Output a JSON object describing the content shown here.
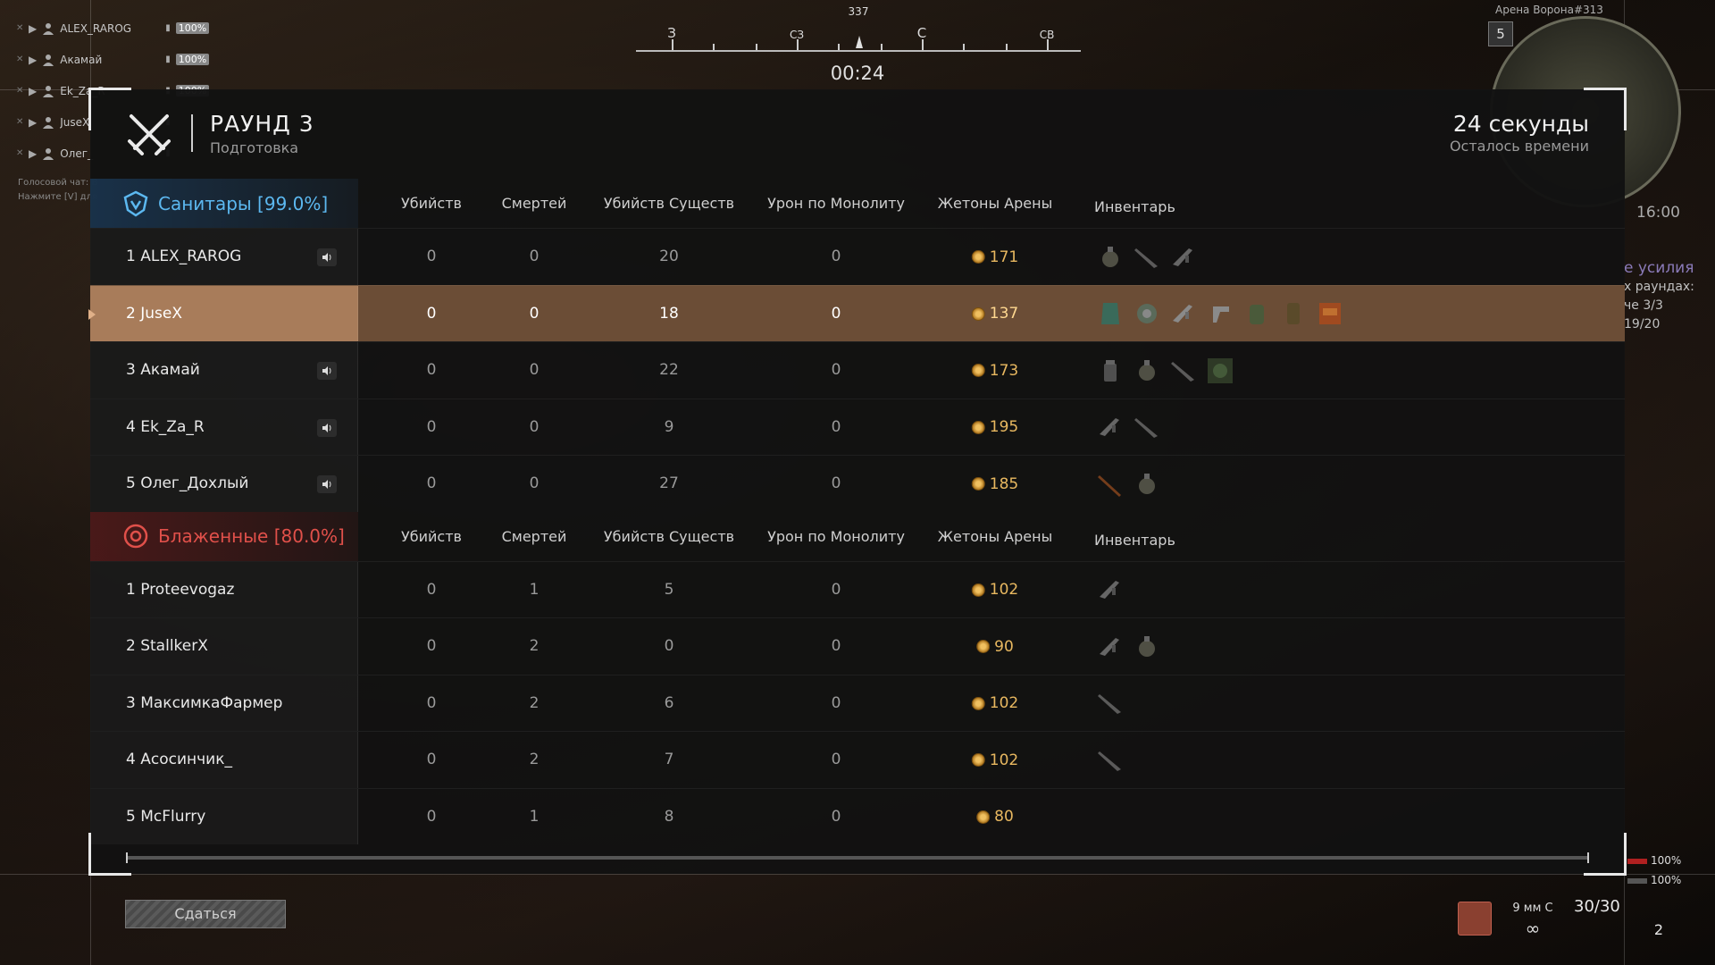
{
  "squad": {
    "members": [
      {
        "name": "ALEX_RAROG",
        "health": "100%"
      },
      {
        "name": "Акамай",
        "health": "100%"
      },
      {
        "name": "Ek_Za_R",
        "health": "100%"
      },
      {
        "name": "JuseX",
        "health": ""
      },
      {
        "name": "Олег_",
        "health": ""
      }
    ],
    "voice_note_1": "Голосовой чат: В",
    "voice_note_2": "Нажмите [V] для"
  },
  "compass": {
    "bearing": "337",
    "dir_w": "З",
    "dir_nw": "СЗ",
    "dir_n": "С",
    "dir_ne": "СВ"
  },
  "round_timer": "00:24",
  "minimap": {
    "map_name": "Арена Ворона#313",
    "level": "5",
    "clock": "16:00"
  },
  "task": {
    "line1": "е усилия",
    "line2": "х раундах:",
    "line3": "че 3/3",
    "line4": "19/20"
  },
  "header": {
    "round_title": "РАУНД 3",
    "round_phase": "Подготовка",
    "time_left": "24 секунды",
    "time_caption": "Осталось времени"
  },
  "columns": {
    "kills": "Убийств",
    "deaths": "Смертей",
    "creature_kills": "Убийств Существ",
    "monolith_damage": "Урон по Монолиту",
    "arena_tokens": "Жетоны Арены",
    "inventory": "Инвентарь"
  },
  "teams": [
    {
      "name": "Санитары [99.0%]",
      "color": "#5cb8f0",
      "players": [
        {
          "rank_name": "1 ALEX_RAROG",
          "kills": "0",
          "deaths": "0",
          "creatures": "20",
          "monolith": "0",
          "tokens": "171",
          "voice": true,
          "items": [
            "grenade-icon",
            "knife-icon",
            "rifle-icon"
          ]
        },
        {
          "rank_name": "2 JuseX",
          "kills": "0",
          "deaths": "0",
          "creatures": "18",
          "monolith": "0",
          "tokens": "137",
          "voice": false,
          "highlight": true,
          "items": [
            "vest-icon",
            "shield-icon",
            "rifle-icon",
            "pistol-icon",
            "backpack-icon",
            "canister-icon",
            "crate-icon"
          ]
        },
        {
          "rank_name": "3 Акамай",
          "kills": "0",
          "deaths": "0",
          "creatures": "22",
          "monolith": "0",
          "tokens": "173",
          "voice": true,
          "items": [
            "jar-icon",
            "grenade-icon",
            "knife-icon",
            "artifact-box-icon"
          ]
        },
        {
          "rank_name": "4 Ek_Za_R",
          "kills": "0",
          "deaths": "0",
          "creatures": "9",
          "monolith": "0",
          "tokens": "195",
          "voice": true,
          "items": [
            "rifle-icon",
            "knife-icon"
          ]
        },
        {
          "rank_name": "5 Олег_Дохлый",
          "kills": "0",
          "deaths": "0",
          "creatures": "27",
          "monolith": "0",
          "tokens": "185",
          "voice": true,
          "items": [
            "shotgun-icon",
            "grenade-icon"
          ]
        }
      ]
    },
    {
      "name": "Блаженные [80.0%]",
      "color": "#e0504a",
      "players": [
        {
          "rank_name": "1 Proteevogaz",
          "kills": "0",
          "deaths": "1",
          "creatures": "5",
          "monolith": "0",
          "tokens": "102",
          "voice": false,
          "items": [
            "rifle-icon"
          ]
        },
        {
          "rank_name": "2 StallkerX",
          "kills": "0",
          "deaths": "2",
          "creatures": "0",
          "monolith": "0",
          "tokens": "90",
          "voice": false,
          "items": [
            "rifle-icon",
            "grenade-icon"
          ]
        },
        {
          "rank_name": "3 МаксимкаФармер",
          "kills": "0",
          "deaths": "2",
          "creatures": "6",
          "monolith": "0",
          "tokens": "102",
          "voice": false,
          "items": [
            "knife-icon"
          ]
        },
        {
          "rank_name": "4 Асосинчик_",
          "kills": "0",
          "deaths": "2",
          "creatures": "7",
          "monolith": "0",
          "tokens": "102",
          "voice": false,
          "items": [
            "knife-icon"
          ]
        },
        {
          "rank_name": "5 McFlurry",
          "kills": "0",
          "deaths": "1",
          "creatures": "8",
          "monolith": "0",
          "tokens": "80",
          "voice": false,
          "items": []
        }
      ]
    }
  ],
  "surrender_label": "Сдаться",
  "hud": {
    "health_1": "100%",
    "health_2": "100%",
    "caliber": "9 мм С",
    "ammo": "30/30",
    "infinity": "∞",
    "grenades": "2"
  }
}
